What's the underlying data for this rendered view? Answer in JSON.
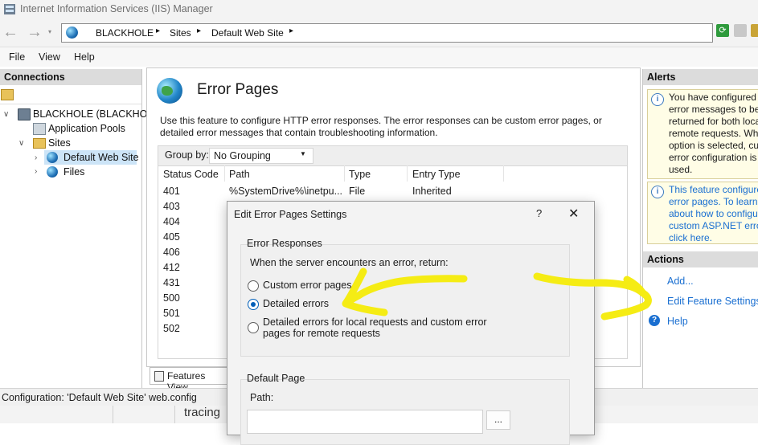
{
  "window": {
    "title": "Internet Information Services (IIS) Manager"
  },
  "address": {
    "crumbs": [
      "BLACKHOLE",
      "Sites",
      "Default Web Site"
    ],
    "separator": "▸"
  },
  "menu": [
    "File",
    "View",
    "Help"
  ],
  "connections": {
    "header": "Connections",
    "tree": {
      "server": "BLACKHOLE (BLACKHOLE",
      "app_pools": "Application Pools",
      "sites": "Sites",
      "default_site": "Default Web Site",
      "files": "Files"
    }
  },
  "feature": {
    "title": "Error Pages",
    "description": "Use this feature to configure HTTP error responses. The error responses can be custom error pages, or detailed error messages that contain troubleshooting information.",
    "group_by_label": "Group by:",
    "group_by_value": "No Grouping",
    "columns": [
      "Status Code",
      "Path",
      "Type",
      "Entry Type"
    ],
    "rows": [
      {
        "code": "401",
        "path": "%SystemDrive%\\inetpu...",
        "type": "File",
        "entry": "Inherited"
      },
      {
        "code": "403"
      },
      {
        "code": "404"
      },
      {
        "code": "405"
      },
      {
        "code": "406"
      },
      {
        "code": "412"
      },
      {
        "code": "431"
      },
      {
        "code": "500"
      },
      {
        "code": "501"
      },
      {
        "code": "502"
      }
    ],
    "features_view_tab": "Features View"
  },
  "status": "Configuration: 'Default Web Site' web.config",
  "bottom_text": "tracing",
  "alerts": {
    "header": "Alerts",
    "alert1": "You have configured error messages to be returned for both local remote requests. When option is selected, cu error configuration is used.",
    "alert2": "This feature configure error pages. To learn n about how to configu custom ASP.NET erro click here."
  },
  "actions": {
    "header": "Actions",
    "add": "Add...",
    "edit": "Edit Feature Settings...",
    "help": "Help"
  },
  "dialog": {
    "title": "Edit Error Pages Settings",
    "help": "?",
    "close": "✕",
    "error_responses_title": "Error Responses",
    "prompt": "When the server encounters an error, return:",
    "options": [
      {
        "label": "Custom error pages",
        "selected": false
      },
      {
        "label": "Detailed errors",
        "selected": true
      },
      {
        "label": "Detailed errors for local requests and custom error pages for remote requests",
        "selected": false
      }
    ],
    "default_page_title": "Default Page",
    "path_label": "Path:",
    "path_value": "",
    "browse": "..."
  },
  "colors": {
    "highlight": "#f5ec14",
    "link": "#1a6fd1",
    "radio_selected": "#005fb8"
  }
}
